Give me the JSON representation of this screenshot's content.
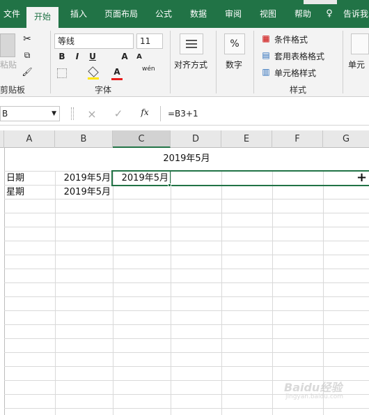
{
  "tabs": [
    "文件",
    "开始",
    "插入",
    "页面布局",
    "公式",
    "数据",
    "审阅",
    "视图",
    "帮助",
    "告诉我"
  ],
  "clipboard": {
    "paste": "粘贴",
    "group": "剪贴板"
  },
  "font": {
    "name": "等线",
    "size": "11",
    "group": "字体",
    "bold": "B",
    "italic": "I",
    "underline": "U",
    "grow": "A",
    "shrink": "A",
    "font_color": "A",
    "phonetic": "wén"
  },
  "alignment": {
    "label": "对齐方式"
  },
  "number": {
    "label": "数字",
    "symbol": "%"
  },
  "styles": {
    "conditional": "条件格式",
    "table": "套用表格格式",
    "cell": "单元格样式",
    "group": "样式"
  },
  "cells": {
    "label": "单元"
  },
  "formula_bar": {
    "name_box": "B",
    "cancel": "×",
    "enter": "✓",
    "fx": "fx",
    "formula": "=B3+1"
  },
  "columns": [
    "A",
    "B",
    "C",
    "D",
    "E",
    "F",
    "G"
  ],
  "sheet": {
    "title": "2019年5月",
    "row1": {
      "a": "日期",
      "b": "2019年5月",
      "c": "2019年5月"
    },
    "row2": {
      "a": "星期",
      "b": "2019年5月"
    }
  },
  "watermark": {
    "brand": "Baidu经验",
    "url": "jingyan.baidu.com"
  }
}
